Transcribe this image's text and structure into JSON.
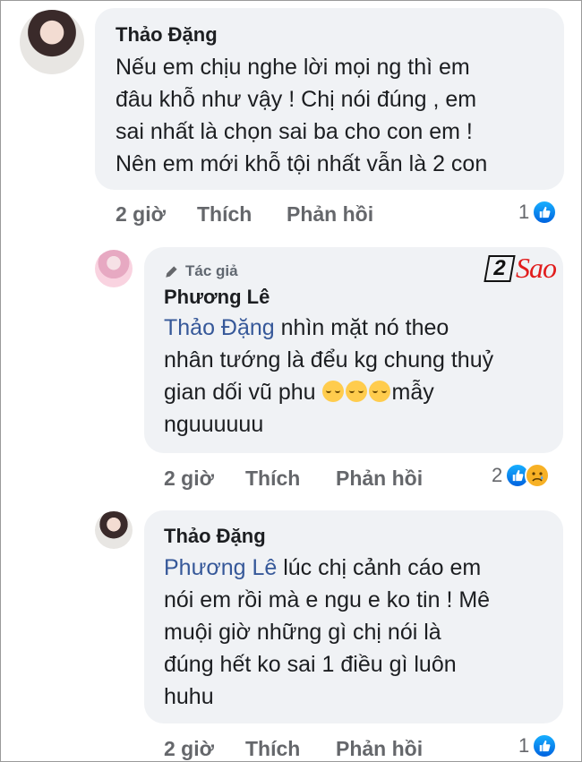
{
  "watermark": {
    "number": "2",
    "word": "Sao"
  },
  "comments": [
    {
      "author": "Thảo Đặng",
      "lines": [
        "Nếu em chịu nghe lời mọi ng thì em",
        "đâu khỗ như vậy ! Chị nói đúng , em",
        "sai nhất là chọn sai ba cho con em !",
        "Nên em mới khỗ tội nhất vẫn là 2 con"
      ],
      "time": "2 giờ",
      "like_label": "Thích",
      "reply_label": "Phản hồi",
      "reaction_count": "1"
    },
    {
      "badge": "Tác giả",
      "author": "Phương Lê",
      "mention": "Thảo Đặng",
      "line1_rest": " nhìn mặt nó theo",
      "line2": "nhân tướng là đểu kg chung thuỷ",
      "line3_start": "gian dối vũ  phu ",
      "line3_end": "mẫy",
      "line4": "nguuuuuu",
      "emojis": [
        "relieved-face",
        "relieved-face",
        "relieved-face"
      ],
      "time": "2 giờ",
      "like_label": "Thích",
      "reply_label": "Phản hồi",
      "reaction_count": "2"
    },
    {
      "author": "Thảo Đặng",
      "mention": "Phương Lê",
      "line1_rest": "  lúc chị cảnh cáo em",
      "lines": [
        "nói em rồi mà e ngu e ko tin ! Mê",
        "muội giờ những gì chị nói là",
        "đúng hết ko sai 1 điều gì luôn",
        "huhu"
      ],
      "time": "2 giờ",
      "like_label": "Thích",
      "reply_label": "Phản hồi",
      "reaction_count": "1"
    }
  ]
}
